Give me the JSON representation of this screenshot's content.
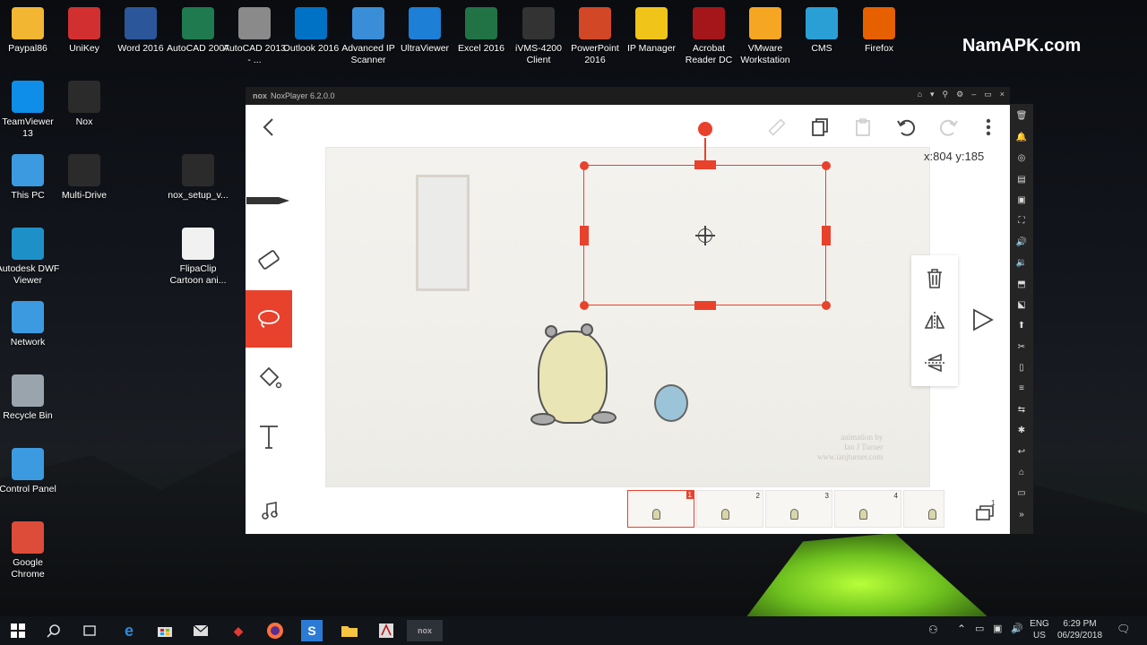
{
  "brand": "NamAPK.com",
  "desktop_icons": [
    {
      "label": "Paypal86",
      "color": "#f2b632"
    },
    {
      "label": "UniKey",
      "color": "#d23030"
    },
    {
      "label": "Word 2016",
      "color": "#2b579a"
    },
    {
      "label": "AutoCAD 2007",
      "color": "#1f7a4f"
    },
    {
      "label": "AutoCAD 2013 - ...",
      "color": "#8a8a8a"
    },
    {
      "label": "Outlook 2016",
      "color": "#0072c6"
    },
    {
      "label": "Advanced IP Scanner",
      "color": "#3a8ed8"
    },
    {
      "label": "UltraViewer",
      "color": "#1d7fd6"
    },
    {
      "label": "Excel 2016",
      "color": "#217346"
    },
    {
      "label": "iVMS-4200 Client",
      "color": "#333333"
    },
    {
      "label": "PowerPoint 2016",
      "color": "#d24726"
    },
    {
      "label": "IP Manager",
      "color": "#f0c419"
    },
    {
      "label": "Acrobat Reader DC",
      "color": "#a4161a"
    },
    {
      "label": "VMware Workstation",
      "color": "#f5a623"
    },
    {
      "label": "CMS",
      "color": "#2a9fd6"
    },
    {
      "label": "Firefox",
      "color": "#e66000"
    },
    {
      "label": "TeamViewer 13",
      "color": "#0e8ee9"
    },
    {
      "label": "Nox",
      "color": "#2b2b2b"
    },
    {
      "label": "This PC",
      "color": "#3c9ae0"
    },
    {
      "label": "Multi-Drive",
      "color": "#2b2b2b"
    },
    {
      "label": "nox_setup_v...",
      "color": "#2b2b2b"
    },
    {
      "label": "Autodesk DWF Viewer",
      "color": "#1e90c8"
    },
    {
      "label": "FlipaClip Cartoon ani...",
      "color": "#f1f1f1"
    },
    {
      "label": "Network",
      "color": "#3c9ae0"
    },
    {
      "label": "Recycle Bin",
      "color": "#9aa4ad"
    },
    {
      "label": "Control Panel",
      "color": "#3c9ae0"
    },
    {
      "label": "Google Chrome",
      "color": "#dd4b39"
    }
  ],
  "nox": {
    "title": "NoxPlayer 6.2.0.0",
    "logo": "nox",
    "controls": [
      "⌂",
      "▾",
      "⚲",
      "⚙",
      "–",
      "▭",
      "×"
    ],
    "side_icons": [
      "🗑",
      "🔔",
      "◎",
      "▤",
      "▣",
      "⛶",
      "🔊",
      "🔉",
      "⬒",
      "⬕",
      "⬆",
      "✂",
      "▯",
      "≡",
      "⇆",
      "✱",
      "↩",
      "⌂",
      "▭",
      "»"
    ]
  },
  "app": {
    "coord_readout": "x:804 y:185",
    "credit_line1": "animation by",
    "credit_line2": "Ian J Turner",
    "credit_line3": "www.ianjturner.com",
    "frames": [
      {
        "num": "1",
        "active": true
      },
      {
        "num": "2",
        "active": false
      },
      {
        "num": "3",
        "active": false
      },
      {
        "num": "4",
        "active": false
      },
      {
        "num": "",
        "active": false
      }
    ],
    "layers_count": "1",
    "accent": "#e8412c"
  },
  "taskbar": {
    "lang": "ENG",
    "region": "US",
    "time": "6:29 PM",
    "date": "06/29/2018"
  }
}
